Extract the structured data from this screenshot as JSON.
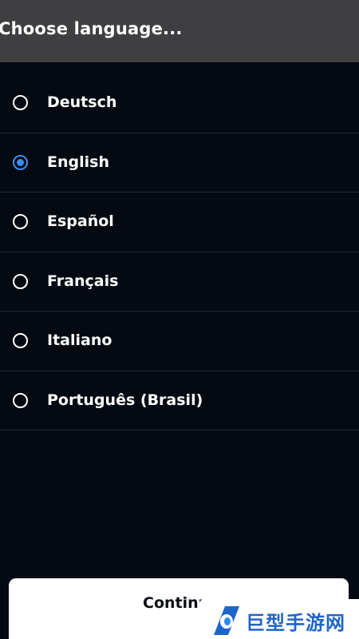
{
  "header": {
    "title": "Choose language..."
  },
  "languages": [
    {
      "label": "Deutsch",
      "selected": false
    },
    {
      "label": "English",
      "selected": true
    },
    {
      "label": "Español",
      "selected": false
    },
    {
      "label": "Français",
      "selected": false
    },
    {
      "label": "Italiano",
      "selected": false
    },
    {
      "label": "Português (Brasil)",
      "selected": false
    }
  ],
  "footer": {
    "continue_label": "Continue"
  },
  "watermark": {
    "text": "巨型手游网"
  },
  "colors": {
    "background": "#050912",
    "header_bg": "#3f3f42",
    "accent": "#3c8ff0",
    "watermark": "#1f64c8"
  }
}
